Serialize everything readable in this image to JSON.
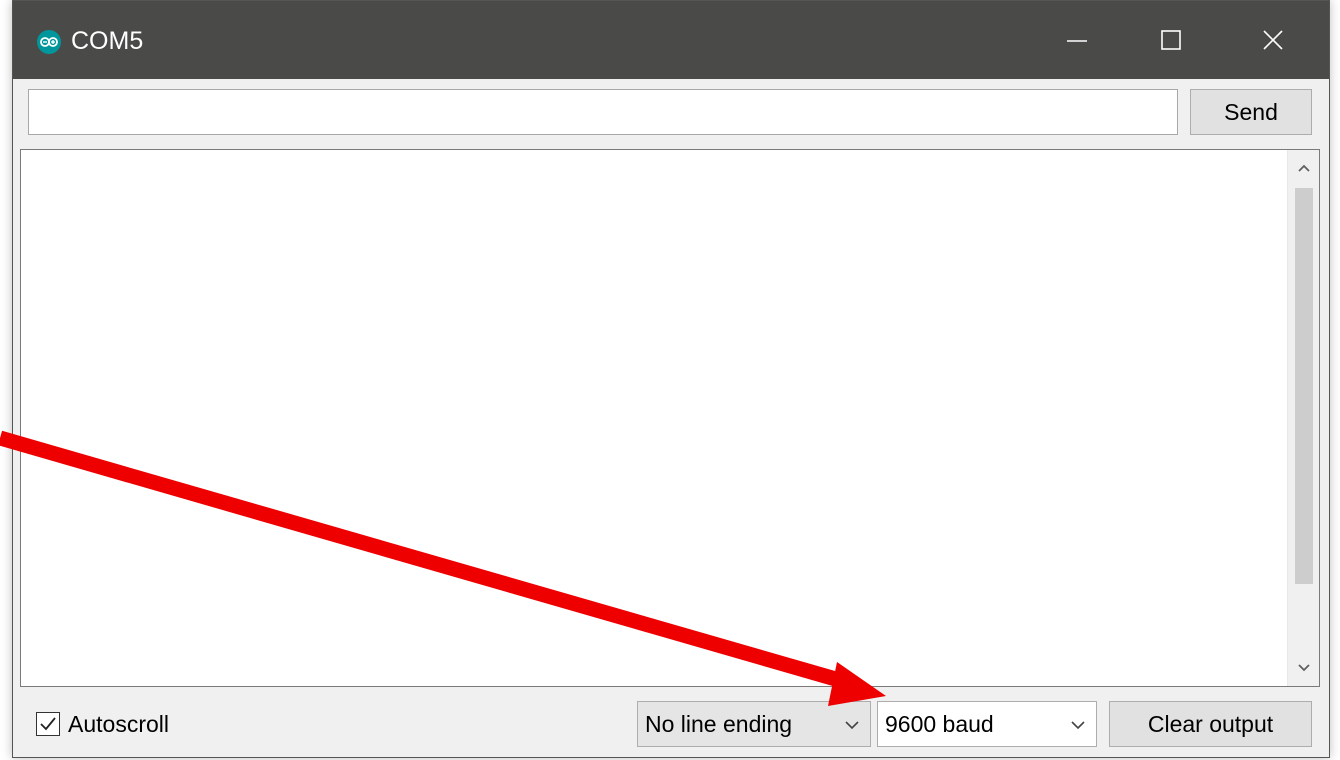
{
  "window": {
    "title": "COM5",
    "app_icon": "arduino-icon"
  },
  "send_row": {
    "input_value": "",
    "send_label": "Send"
  },
  "output": {
    "text": ""
  },
  "bottom_bar": {
    "autoscroll_label": "Autoscroll",
    "autoscroll_checked": true,
    "line_ending_value": "No line ending",
    "baud_value": "9600 baud",
    "clear_label": "Clear output"
  },
  "annotation": {
    "arrow_color": "#ee0000"
  },
  "colors": {
    "titlebar": "#4a4a48",
    "arduino_teal": "#00979c"
  }
}
